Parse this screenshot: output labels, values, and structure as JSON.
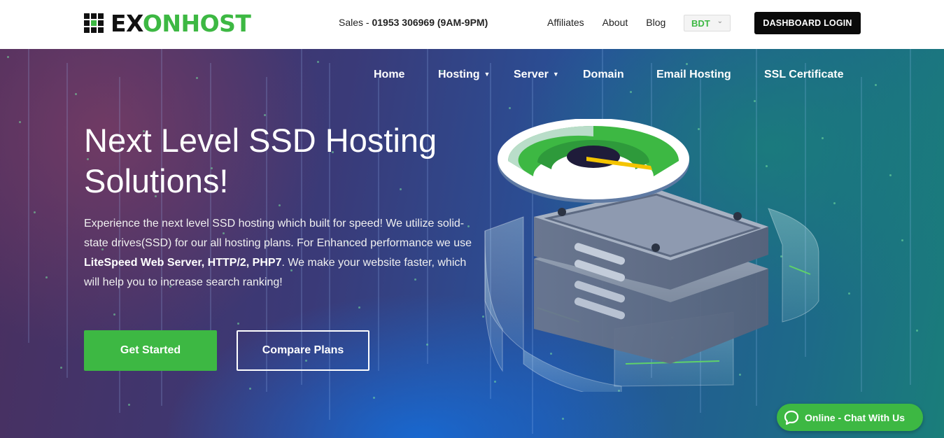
{
  "brand": {
    "logo_prefix": "EX",
    "logo_o": "O",
    "logo_suffix": "NHOST",
    "accent_color": "#3db843"
  },
  "header": {
    "sales_label": "Sales - ",
    "sales_phone": "01953 306969 (9AM-9PM)",
    "links": [
      "Affiliates",
      "About",
      "Blog"
    ],
    "currency": "BDT",
    "dashboard_button": "DASHBOARD LOGIN"
  },
  "nav": {
    "home": "Home",
    "hosting": "Hosting",
    "server": "Server",
    "domain": "Domain",
    "email": "Email Hosting",
    "ssl": "SSL Certificate"
  },
  "hero": {
    "headline": "Next Level SSD Hosting Solutions!",
    "desc_1": "Experience the next level SSD hosting which built for speed! We utilize solid-state drives(SSD) for our all hosting plans. For Enhanced performance we use ",
    "desc_bold": "LiteSpeed Web Server, HTTP/2, PHP7",
    "desc_2": ". We make your website faster, which will help you to increase search ranking!",
    "cta_primary": "Get Started",
    "cta_secondary": "Compare Plans"
  },
  "chat": {
    "label": "Online - Chat With Us"
  },
  "icons": [
    "logo-grid-icon",
    "dropdown-caret-icon",
    "speed-gauge-server-illustration",
    "chat-bubble-icon"
  ]
}
